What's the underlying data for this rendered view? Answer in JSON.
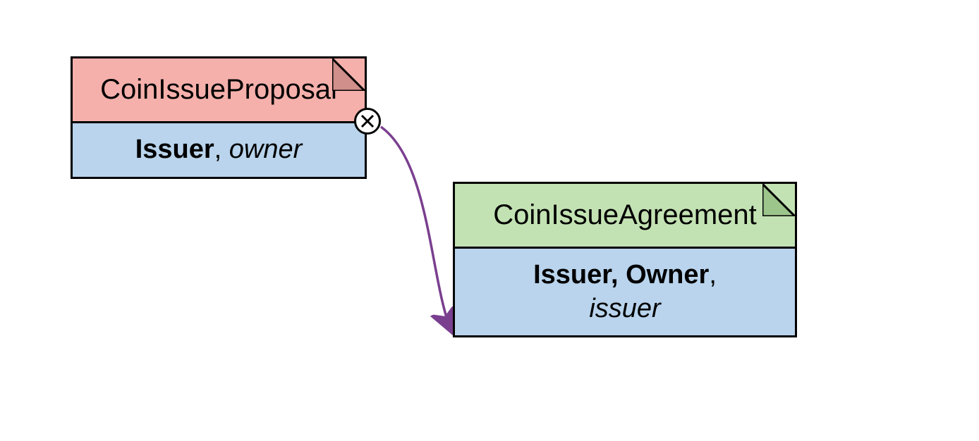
{
  "nodes": {
    "proposal": {
      "title": "CoinIssueProposal",
      "signatory": "Issuer",
      "separator": ", ",
      "observer": "owner"
    },
    "agreement": {
      "title": "CoinIssueAgreement",
      "signatories": "Issuer, Owner",
      "separator": ", ",
      "observer": "issuer"
    }
  },
  "relation": {
    "type": "consuming-choice",
    "from": "CoinIssueProposal",
    "to": "CoinIssueAgreement"
  },
  "colors": {
    "proposal_bg": "#f5b0ab",
    "agreement_bg": "#c3e2b3",
    "body_bg": "#b9d4ec",
    "arrow": "#7a3f8f"
  }
}
